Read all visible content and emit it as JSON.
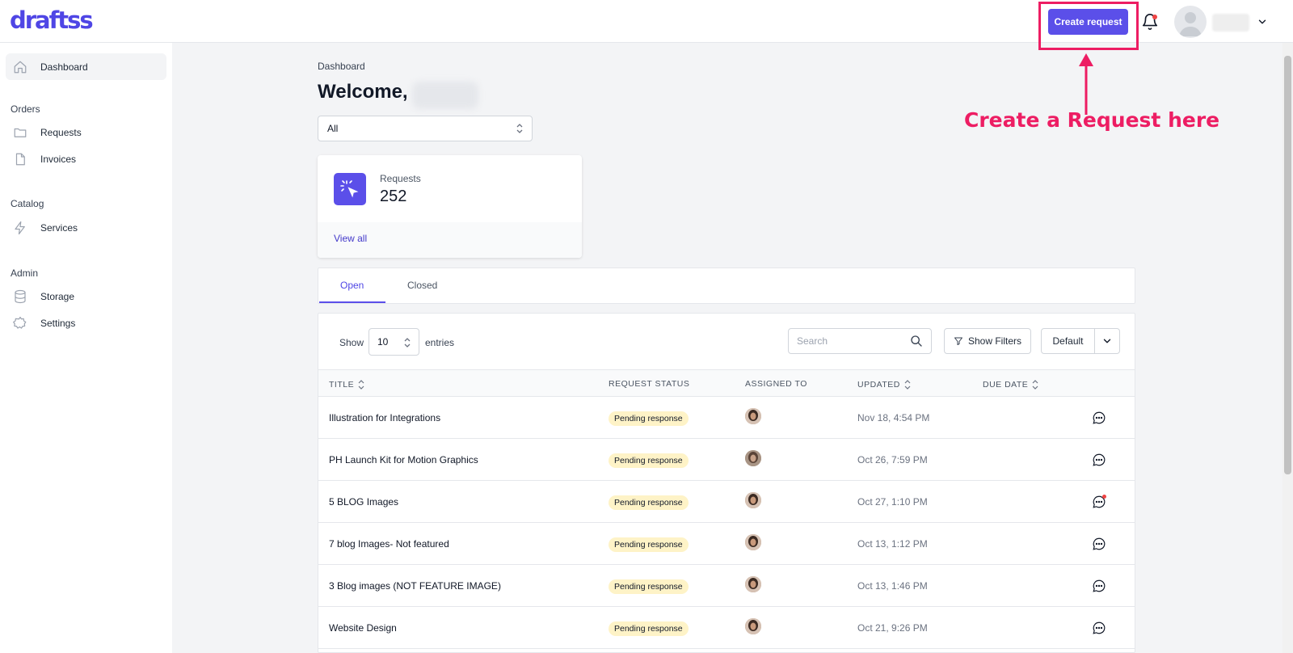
{
  "app": {
    "logo": "draftss"
  },
  "header": {
    "create_label": "Create request",
    "icons": [
      "bell-icon",
      "user-avatar",
      "chevron-down-icon"
    ]
  },
  "sidebar": {
    "dashboard": "Dashboard",
    "sections": {
      "orders": "Orders",
      "catalog": "Catalog",
      "admin": "Admin"
    },
    "items": {
      "requests": "Requests",
      "invoices": "Invoices",
      "services": "Services",
      "storage": "Storage",
      "settings": "Settings"
    }
  },
  "main": {
    "breadcrumb": "Dashboard",
    "welcome": "Welcome,",
    "filter_value": "All",
    "stat": {
      "label": "Requests",
      "value": "252",
      "link": "View all"
    },
    "tabs": {
      "open": "Open",
      "closed": "Closed"
    }
  },
  "table": {
    "show_label": "Show",
    "entries_value": "10",
    "entries_label": "entries",
    "search_placeholder": "Search",
    "filters_label": "Show Filters",
    "sort_label": "Default",
    "headers": {
      "title": "TITLE",
      "status": "REQUEST STATUS",
      "assigned": "ASSIGNED TO",
      "updated": "UPDATED",
      "due": "DUE DATE"
    },
    "rows": [
      {
        "title": "Illustration for Integrations",
        "status": "Pending response",
        "updated": "Nov 18, 4:54 PM"
      },
      {
        "title": "PH Launch Kit for Motion Graphics",
        "status": "Pending response",
        "updated": "Oct 26, 7:59 PM"
      },
      {
        "title": "5 BLOG Images",
        "status": "Pending response",
        "updated": "Oct 27, 1:10 PM"
      },
      {
        "title": "7 blog Images- Not featured",
        "status": "Pending response",
        "updated": "Oct 13, 1:12 PM"
      },
      {
        "title": "3 Blog images (NOT FEATURE IMAGE)",
        "status": "Pending response",
        "updated": "Oct 13, 1:46 PM"
      },
      {
        "title": "Website Design",
        "status": "Pending response",
        "updated": "Oct 21, 9:26 PM"
      }
    ]
  },
  "annotation": {
    "text": "Create a Request here",
    "color": "#ed1d63"
  },
  "colors": {
    "brand": "#5b4fe9",
    "badge_bg": "#fef3c7"
  }
}
